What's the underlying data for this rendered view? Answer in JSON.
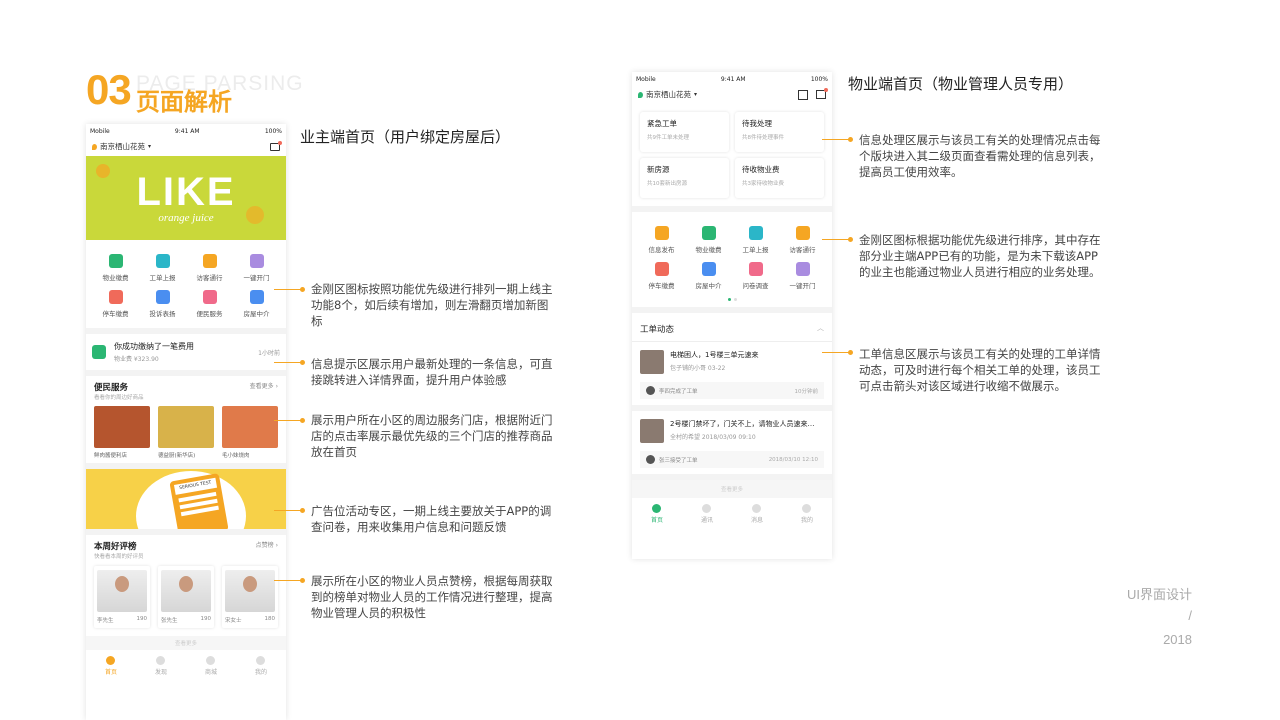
{
  "header": {
    "number": "03",
    "bg_word": "PAGE PARSING",
    "title": "页面解析"
  },
  "left": {
    "section_title": "业主端首页（用户绑定房屋后）",
    "phone": {
      "status": {
        "carrier": "Mobile",
        "time": "9:41 AM",
        "battery": "100%"
      },
      "location": "南京栖山花苑",
      "banner_text": "LIKE",
      "banner_sub": "orange juice",
      "icons": [
        {
          "label": "物业缴费",
          "color": "#2bb673"
        },
        {
          "label": "工单上报",
          "color": "#2bb6c8"
        },
        {
          "label": "访客通行",
          "color": "#f5a623"
        },
        {
          "label": "一键开门",
          "color": "#a98ce0"
        },
        {
          "label": "停车缴费",
          "color": "#f06a5a"
        },
        {
          "label": "投诉表扬",
          "color": "#4a8ef0"
        },
        {
          "label": "便民服务",
          "color": "#f06a8a"
        },
        {
          "label": "房屋中介",
          "color": "#4a8ef0"
        }
      ],
      "msg": {
        "title": "你成功缴纳了一笔费用",
        "sub": "物业费 ¥323.90",
        "time": "1小时前"
      },
      "services": {
        "title": "便民服务",
        "sub": "看看你的周边好商品",
        "more": "查看更多",
        "items": [
          "鲜肉酱便利店",
          "德益厨(新华店)",
          "毛小妹烧肉"
        ]
      },
      "ad": {
        "text": "SERIOUS TEST"
      },
      "ranking": {
        "title": "本周好评榜",
        "sub": "快看看本周的好评员",
        "more": "点赞榜",
        "people": [
          {
            "name": "李先生",
            "count": "190"
          },
          {
            "name": "张先生",
            "count": "190"
          },
          {
            "name": "宋女士",
            "count": "180"
          }
        ]
      },
      "more_text": "查看更多",
      "tabs": [
        "首页",
        "发现",
        "商城",
        "我的"
      ]
    },
    "notes": [
      "金刚区图标按照功能优先级进行排列一期上线主功能8个，如后续有增加，则左滑翻页增加新图标",
      "信息提示区展示用户最新处理的一条信息，可直接跳转进入详情界面，提升用户体验感",
      "展示用户所在小区的周边服务门店，根据附近门店的点击率展示最优先级的三个门店的推荐商品放在首页",
      "广告位活动专区，一期上线主要放关于APP的调查问卷，用来收集用户信息和问题反馈",
      "展示所在小区的物业人员点赞榜，根据每周获取到的榜单对物业人员的工作情况进行整理，提高物业管理人员的积极性"
    ]
  },
  "right": {
    "section_title": "物业端首页（物业管理人员专用）",
    "phone": {
      "status": {
        "carrier": "Mobile",
        "time": "9:41 AM",
        "battery": "100%"
      },
      "location": "南京栖山花苑",
      "cards": [
        {
          "title": "紧急工单",
          "sub": "共9件工单未处理"
        },
        {
          "title": "待我处理",
          "sub": "共8件待处理事件"
        },
        {
          "title": "新房源",
          "sub": "共10套新出房源"
        },
        {
          "title": "待收物业费",
          "sub": "共3家待收物业费"
        }
      ],
      "icons": [
        {
          "label": "信息发布",
          "color": "#f5a623"
        },
        {
          "label": "物业缴费",
          "color": "#2bb673"
        },
        {
          "label": "工单上报",
          "color": "#2bb6c8"
        },
        {
          "label": "访客通行",
          "color": "#f5a623"
        },
        {
          "label": "停车缴费",
          "color": "#f06a5a"
        },
        {
          "label": "房屋中介",
          "color": "#4a8ef0"
        },
        {
          "label": "问卷调查",
          "color": "#f06a8a"
        },
        {
          "label": "一键开门",
          "color": "#a98ce0"
        }
      ],
      "orders_title": "工单动态",
      "orders": [
        {
          "title": "电梯困人，1号楼三单元速来",
          "sub": "包子铺的小哥 03-22",
          "footer": "李四完成了工单",
          "time": "10分钟前"
        },
        {
          "title": "2号楼门禁坏了，门关不上，请物业人员速来…",
          "sub": "全村的希望 2018/03/09 09:10",
          "footer": "张三接受了工单",
          "time": "2018/03/10 12:10"
        }
      ],
      "more_text": "查看更多",
      "tabs": [
        "首页",
        "通讯",
        "消息",
        "我的"
      ]
    },
    "notes": [
      "信息处理区展示与该员工有关的处理情况点击每个版块进入其二级页面查看需处理的信息列表，提高员工使用效率。",
      "金刚区图标根据功能优先级进行排序，其中存在部分业主端APP已有的功能，是为未下载该APP的业主也能通过物业人员进行相应的业务处理。",
      "工单信息区展示与该员工有关的处理的工单详情动态，可及时进行每个相关工单的处理，该员工可点击箭头对该区域进行收缩不做展示。"
    ]
  },
  "footer": {
    "line1": "UI界面设计",
    "line2": "/",
    "line3": "2018"
  },
  "colors": {
    "accent": "#f5a623",
    "green": "#2bb673",
    "banner": "#c9d83a",
    "ad": "#f7d148"
  }
}
